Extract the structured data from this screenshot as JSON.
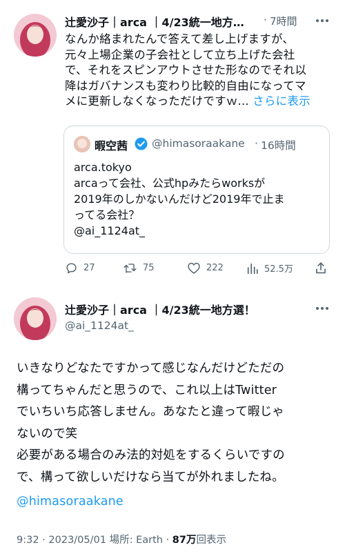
{
  "reply": {
    "author_name": "辻愛沙子｜arca ｜4/23統一地方…",
    "time_sep": "·",
    "time": "7時間",
    "lines": [
      "なんか絡まれたんで答えて差し上げますが、",
      "元々上場企業の子会社として立ち上げた会社",
      "で、それをスピンアウトさせた形なのでそれ以",
      "降はガバナンスも変わり比較的自由になってマ",
      "メに更新しなくなっただけですｗ..."
    ],
    "show_more": "さらに表示",
    "quote": {
      "name": "暇空茜",
      "handle": "@himasoraakane",
      "time_sep": "·",
      "time": "16時間",
      "lines": [
        "arca.tokyo",
        "arcaって会社、公式hpみたらworksが",
        "2019年のしかないんだけど2019年で止ま",
        "ってる会社？",
        "@ai_1124at_"
      ]
    },
    "actions": {
      "replies": "27",
      "retweets": "75",
      "likes": "222",
      "views": "52.5万"
    }
  },
  "main": {
    "author_name": "辻愛沙子｜arca ｜4/23統一地方選！",
    "handle": "@ai_1124at_",
    "lines": [
      "いきなりどなたですかって感じなんだけどただの",
      "構ってちゃんだと思うので、これ以上はTwitter",
      "でいちいち応答しません。あなたと違って暇じゃ",
      "ないので笑",
      "必要がある場合のみ法的対処をするくらいですの",
      "で、構って欲しいだけなら当てが外れましたね。"
    ],
    "mention": "@himasoraakane",
    "meta": {
      "time": "9:32",
      "sep1": "·",
      "date": "2023/05/01",
      "location_label": "場所: Earth",
      "sep2": "·",
      "views_count": "87万",
      "views_label": "回表示"
    }
  },
  "colors": {
    "accent": "#1d9bf0",
    "muted": "#536471",
    "border": "#cfd9de"
  }
}
